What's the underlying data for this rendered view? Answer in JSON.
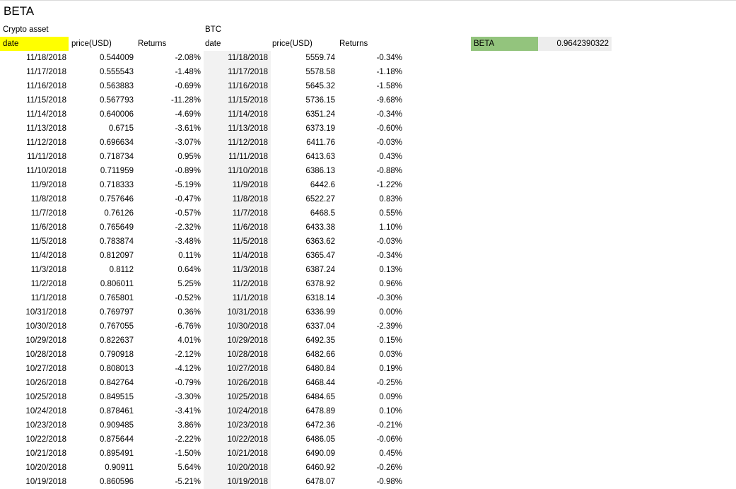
{
  "sheet": {
    "title": "BETA",
    "section_label": "Crypto asset",
    "btc_label": "BTC",
    "headers": [
      "date",
      "price(USD)",
      "Returns",
      "date",
      "price(USD)",
      "Returns"
    ],
    "beta_label": "BETA",
    "beta_value": "0.9642390322",
    "colors": {
      "date_header_highlight": "#ffff00",
      "beta_label_fill": "#93c47d",
      "beta_value_fill": "#ededed"
    },
    "rows": [
      [
        "11/18/2018",
        "0.544009",
        "-2.08%",
        "11/18/2018",
        "5559.74",
        "-0.34%"
      ],
      [
        "11/17/2018",
        "0.555543",
        "-1.48%",
        "11/17/2018",
        "5578.58",
        "-1.18%"
      ],
      [
        "11/16/2018",
        "0.563883",
        "-0.69%",
        "11/16/2018",
        "5645.32",
        "-1.58%"
      ],
      [
        "11/15/2018",
        "0.567793",
        "-11.28%",
        "11/15/2018",
        "5736.15",
        "-9.68%"
      ],
      [
        "11/14/2018",
        "0.640006",
        "-4.69%",
        "11/14/2018",
        "6351.24",
        "-0.34%"
      ],
      [
        "11/13/2018",
        "0.6715",
        "-3.61%",
        "11/13/2018",
        "6373.19",
        "-0.60%"
      ],
      [
        "11/12/2018",
        "0.696634",
        "-3.07%",
        "11/12/2018",
        "6411.76",
        "-0.03%"
      ],
      [
        "11/11/2018",
        "0.718734",
        "0.95%",
        "11/11/2018",
        "6413.63",
        "0.43%"
      ],
      [
        "11/10/2018",
        "0.711959",
        "-0.89%",
        "11/10/2018",
        "6386.13",
        "-0.88%"
      ],
      [
        "11/9/2018",
        "0.718333",
        "-5.19%",
        "11/9/2018",
        "6442.6",
        "-1.22%"
      ],
      [
        "11/8/2018",
        "0.757646",
        "-0.47%",
        "11/8/2018",
        "6522.27",
        "0.83%"
      ],
      [
        "11/7/2018",
        "0.76126",
        "-0.57%",
        "11/7/2018",
        "6468.5",
        "0.55%"
      ],
      [
        "11/6/2018",
        "0.765649",
        "-2.32%",
        "11/6/2018",
        "6433.38",
        "1.10%"
      ],
      [
        "11/5/2018",
        "0.783874",
        "-3.48%",
        "11/5/2018",
        "6363.62",
        "-0.03%"
      ],
      [
        "11/4/2018",
        "0.812097",
        "0.11%",
        "11/4/2018",
        "6365.47",
        "-0.34%"
      ],
      [
        "11/3/2018",
        "0.8112",
        "0.64%",
        "11/3/2018",
        "6387.24",
        "0.13%"
      ],
      [
        "11/2/2018",
        "0.806011",
        "5.25%",
        "11/2/2018",
        "6378.92",
        "0.96%"
      ],
      [
        "11/1/2018",
        "0.765801",
        "-0.52%",
        "11/1/2018",
        "6318.14",
        "-0.30%"
      ],
      [
        "10/31/2018",
        "0.769797",
        "0.36%",
        "10/31/2018",
        "6336.99",
        "0.00%"
      ],
      [
        "10/30/2018",
        "0.767055",
        "-6.76%",
        "10/30/2018",
        "6337.04",
        "-2.39%"
      ],
      [
        "10/29/2018",
        "0.822637",
        "4.01%",
        "10/29/2018",
        "6492.35",
        "0.15%"
      ],
      [
        "10/28/2018",
        "0.790918",
        "-2.12%",
        "10/28/2018",
        "6482.66",
        "0.03%"
      ],
      [
        "10/27/2018",
        "0.808013",
        "-4.12%",
        "10/27/2018",
        "6480.84",
        "0.19%"
      ],
      [
        "10/26/2018",
        "0.842764",
        "-0.79%",
        "10/26/2018",
        "6468.44",
        "-0.25%"
      ],
      [
        "10/25/2018",
        "0.849515",
        "-3.30%",
        "10/25/2018",
        "6484.65",
        "0.09%"
      ],
      [
        "10/24/2018",
        "0.878461",
        "-3.41%",
        "10/24/2018",
        "6478.89",
        "0.10%"
      ],
      [
        "10/23/2018",
        "0.909485",
        "3.86%",
        "10/23/2018",
        "6472.36",
        "-0.21%"
      ],
      [
        "10/22/2018",
        "0.875644",
        "-2.22%",
        "10/22/2018",
        "6486.05",
        "-0.06%"
      ],
      [
        "10/21/2018",
        "0.895491",
        "-1.50%",
        "10/21/2018",
        "6490.09",
        "0.45%"
      ],
      [
        "10/20/2018",
        "0.90911",
        "5.64%",
        "10/20/2018",
        "6460.92",
        "-0.26%"
      ],
      [
        "10/19/2018",
        "0.860596",
        "-5.21%",
        "10/19/2018",
        "6478.07",
        "-0.98%"
      ]
    ]
  }
}
